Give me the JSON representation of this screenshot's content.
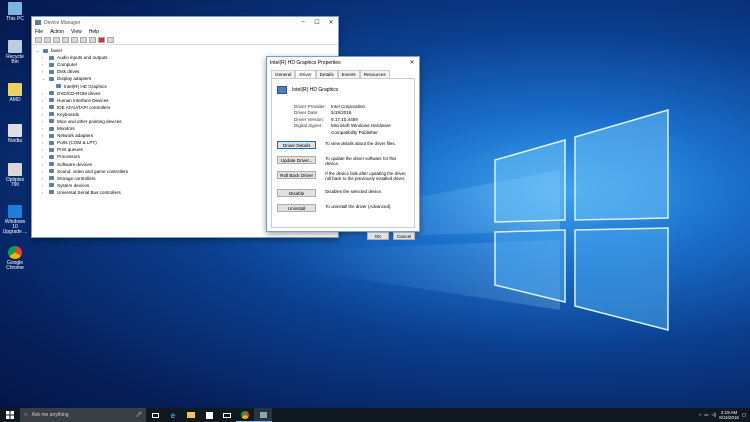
{
  "desktop_icons": [
    {
      "label": "This PC"
    },
    {
      "label": "Recycle Bin"
    },
    {
      "label": "AMD"
    },
    {
      "label": "Nvidia"
    },
    {
      "label": "Optiplex 790"
    },
    {
      "label": "Windows 10 Upgrade ..."
    },
    {
      "label": "Google Chrome"
    }
  ],
  "device_manager": {
    "title": "Device Manager",
    "menus": [
      "File",
      "Action",
      "View",
      "Help"
    ],
    "root": "favier",
    "tree": [
      {
        "label": "Audio inputs and outputs",
        "expanded": false
      },
      {
        "label": "Computer",
        "expanded": false
      },
      {
        "label": "Disk drives",
        "expanded": false
      },
      {
        "label": "Display adapters",
        "expanded": true
      },
      {
        "label": "Intel(R) HD Graphics",
        "child": true
      },
      {
        "label": "DVD/CD-ROM drives",
        "expanded": false
      },
      {
        "label": "Human Interface Devices",
        "expanded": false
      },
      {
        "label": "IDE ATA/ATAPI controllers",
        "expanded": false
      },
      {
        "label": "Keyboards",
        "expanded": false
      },
      {
        "label": "Mice and other pointing devices",
        "expanded": false
      },
      {
        "label": "Monitors",
        "expanded": false
      },
      {
        "label": "Network adapters",
        "expanded": false
      },
      {
        "label": "Ports (COM & LPT)",
        "expanded": false
      },
      {
        "label": "Print queues",
        "expanded": false
      },
      {
        "label": "Processors",
        "expanded": false
      },
      {
        "label": "Software devices",
        "expanded": false
      },
      {
        "label": "Sound, video and game controllers",
        "expanded": false
      },
      {
        "label": "Storage controllers",
        "expanded": false
      },
      {
        "label": "System devices",
        "expanded": false
      },
      {
        "label": "Universal Serial Bus controllers",
        "expanded": false
      }
    ]
  },
  "properties": {
    "title": "Intel(R) HD Graphics Properties",
    "close": "✕",
    "tabs": [
      "General",
      "Driver",
      "Details",
      "Events",
      "Resources"
    ],
    "active_tab": "Driver",
    "device_name": "Intel(R) HD Graphics",
    "fields": [
      {
        "key": "Driver Provider:",
        "value": "Intel Corporation"
      },
      {
        "key": "Driver Date:",
        "value": "5/19/2016"
      },
      {
        "key": "Driver Version:",
        "value": "9.17.10.4459"
      },
      {
        "key": "Digital Signer:",
        "value": "Microsoft Windows Hardware Compatibility Publisher"
      }
    ],
    "actions": [
      {
        "button": "Driver Details",
        "desc": "To view details about the driver files."
      },
      {
        "button": "Update Driver...",
        "desc": "To update the driver software for this device."
      },
      {
        "button": "Roll Back Driver",
        "desc": "If the device fails after updating the driver, roll back to the previously installed driver."
      },
      {
        "button": "Disable",
        "desc": "Disables the selected device."
      },
      {
        "button": "Uninstall",
        "desc": "To uninstall the driver (Advanced)."
      }
    ],
    "ok": "OK",
    "cancel": "Cancel"
  },
  "taskbar": {
    "search_placeholder": "Ask me anything",
    "time": "2:19 AM",
    "date": "8/15/2016"
  },
  "colors": {
    "accent": "#0078d7",
    "taskbar": "#101820"
  }
}
